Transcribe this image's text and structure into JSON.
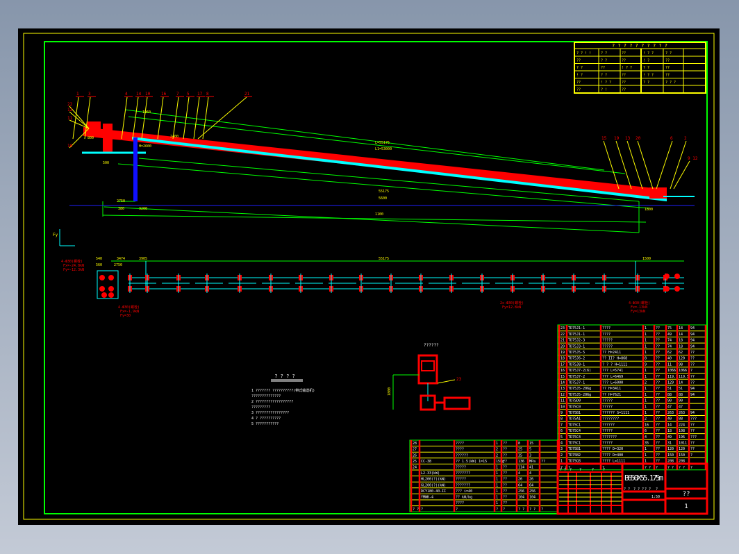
{
  "colors": {
    "frame": "#00ff00",
    "outer": "#ffff00",
    "structure": "#ff0000",
    "belt": "#00ffff",
    "dim": "#ffff00",
    "leader": "#ffff00",
    "pillar": "#1010ff"
  },
  "revision_table": {
    "title": "? ? ? ? ? ? ? ? ? ?",
    "cells": [
      "? ? ! !",
      "? ?",
      "??",
      "! ? ?",
      "? ?",
      "??",
      "? ?",
      "??",
      "! ?",
      "??",
      "? ?",
      "??",
      "! ? ?",
      "? ?",
      "??",
      "! ?",
      "? ?",
      "??",
      "! ? ?",
      "??",
      "??",
      "! ? ?",
      "??",
      "? ?",
      "? ? ?",
      "??",
      "? !",
      "??"
    ]
  },
  "side_view": {
    "top_callouts": [
      "1",
      "3",
      "4",
      "14",
      "10",
      "16",
      "7",
      "5",
      "17",
      "8",
      "21"
    ],
    "left_callouts": [
      "22",
      "12",
      "11",
      "10"
    ],
    "right_callouts": [
      "15",
      "19",
      "13",
      "20",
      "6",
      "2",
      "9  12"
    ],
    "dims": [
      "L=55175",
      "L1=53000",
      "55175",
      "5600",
      "2750",
      "380",
      "3200",
      "1960",
      "2400",
      "1100",
      "1800",
      "800",
      "500",
      "H=2600"
    ],
    "axis_label": "Fy"
  },
  "plan_view": {
    "dims": [
      "540",
      "3474",
      "3905",
      "55175",
      "1500",
      "560",
      "2750"
    ],
    "notes_left": [
      "4-Ф30(螺栓)",
      "Fx=-24.8kN",
      "Fy=-12.3kN"
    ],
    "notes_mid": [
      "2x-Ф30(螺栓)",
      "Fy=12.8kN"
    ],
    "notes_right": [
      "4-Ф30(螺栓)",
      "Fx=-13kN",
      "Fy=13kN"
    ],
    "notes_bottom": [
      "4-Ф30(螺栓)",
      "Fx=-1.9kN",
      "Fy=30"
    ]
  },
  "notes": {
    "title": "? ? ? ?",
    "lines": [
      "1 ??????? ??????????(带式输送机)",
      "  ??????????????",
      "2 ??????????????????",
      "  ?????????",
      "3 ????????????????",
      "4 ? ??????????",
      "5 ???????????"
    ]
  },
  "detail": {
    "title": "??????",
    "labels": [
      "23",
      "1800"
    ]
  },
  "parts": [
    [
      "23",
      "TD75J1-1",
      "????",
      "1",
      "??",
      "75",
      "18",
      "94"
    ],
    [
      "22",
      "TD75J1-1",
      "????",
      "1",
      "??",
      "49",
      "14",
      "94"
    ],
    [
      "21",
      "TD75J2-3",
      "?????",
      "1",
      "??",
      "74",
      "18",
      "94"
    ],
    [
      "20",
      "TD75J3-1",
      "?????",
      "1",
      "??",
      "74",
      "18",
      "94"
    ],
    [
      "19",
      "TD75J5-5",
      "?? H=2411",
      "1",
      "??",
      "62",
      "62",
      "??"
    ],
    [
      "18",
      "TD75J6-2",
      "?? II? H=868",
      "8",
      "??",
      "40",
      "120",
      "??"
    ],
    [
      "17",
      "TD75J8-1",
      "? ? ? H=1111",
      "9",
      "??",
      "11",
      "98",
      "??"
    ],
    [
      "16",
      "TD75J7-2(6)",
      "??? L=5741",
      "1",
      "??",
      "1066",
      "1066",
      "?"
    ],
    [
      "15",
      "TD75J7-2",
      "??? L=6469",
      "1",
      "??",
      "119.5",
      "119.5",
      "??"
    ],
    [
      "14",
      "TD75J7-1",
      "??? L=6000",
      "2",
      "??",
      "129",
      "14",
      "??"
    ],
    [
      "13",
      "TD75J5-206g",
      "?? H=3411",
      "1",
      "??",
      "51",
      "51",
      "94"
    ],
    [
      "12",
      "TD75J5-206g",
      "?? H=7621",
      "1",
      "??",
      "88",
      "88",
      "94"
    ],
    [
      "11",
      "TD75D0",
      "?????",
      "1",
      "??",
      "90",
      "90",
      ""
    ],
    [
      "10",
      "TD75C0",
      "?????",
      "1",
      "??",
      "47",
      "47",
      ""
    ],
    [
      "9",
      "TD75B1",
      "?????? S=1111",
      "1",
      "??",
      "263",
      "263",
      "94"
    ],
    [
      "8",
      "TD75A1",
      "????????",
      "2",
      "??",
      "40",
      "88",
      "???"
    ],
    [
      "7",
      "TD75C1",
      "??????",
      "16",
      "??",
      "14",
      "224",
      "??"
    ],
    [
      "6",
      "TD75C4",
      "?????",
      "6",
      "??",
      "18",
      "108",
      "??"
    ],
    [
      "5",
      "TD75C4",
      "???????",
      "4",
      "??",
      "49",
      "196",
      "???"
    ],
    [
      "4",
      "TD75C1",
      "?????",
      "35",
      "??",
      "31",
      "1011",
      "??"
    ],
    [
      "3",
      "TD75B1",
      "???? D=320",
      "1",
      "??",
      "120",
      "120",
      "??"
    ],
    [
      "2",
      "TD75B2",
      "???? D=400",
      "1",
      "??",
      "150",
      "150",
      "?"
    ],
    [
      "1",
      "TD75Q3",
      "???? L=1111",
      "1",
      "??",
      "208",
      "208",
      ""
    ]
  ],
  "parts_header": [
    "?  ?",
    "?",
    "?",
    "?  ?",
    "?",
    "? ? ?",
    "? ?",
    "?"
  ],
  "lower_parts": [
    [
      "28",
      "",
      "????",
      "1",
      "??",
      "8",
      "15",
      ""
    ],
    [
      "27",
      "",
      "????",
      "2",
      "??",
      "25",
      "5",
      ""
    ],
    [
      "26",
      "",
      "??????",
      "2",
      "??",
      "35",
      "3",
      ""
    ],
    [
      "25",
      "CC-38",
      "?? 1.5(kW) 1=15",
      "15kg",
      "??",
      "136",
      "MPa",
      "??"
    ],
    [
      "24",
      "",
      "?????",
      "1",
      "??",
      "114",
      "41",
      ""
    ],
    [
      "",
      "L2-33(kW)",
      "???????",
      "1",
      "??",
      "4",
      "4",
      ""
    ],
    [
      "",
      "HL200(?)(kW)",
      "?????",
      "1",
      "??",
      "26",
      "26",
      ""
    ],
    [
      "",
      "GL200(?)(kW)",
      "???????",
      "1",
      "??",
      "64",
      "64",
      ""
    ],
    [
      "",
      "DCY180-40-II",
      "??? i=40",
      "1",
      "??",
      "256",
      "256",
      ""
    ],
    [
      "",
      "YMWK-4",
      "?? kW/kg",
      "1",
      "??",
      "104",
      "104",
      ""
    ],
    [
      "",
      "",
      "????",
      "1",
      "??",
      "",
      "",
      ""
    ]
  ],
  "lower_header": [
    "? ?",
    "?",
    "?",
    "?",
    "?",
    "? ?",
    "? ?",
    "?"
  ],
  "title_block": {
    "drawing_name": "B650X55.175m",
    "code": "??",
    "sheet": "1",
    "scale": "1:50",
    "cells": [
      "? ?",
      "?",
      "?",
      "?",
      "?",
      "? ?",
      "? ? ?",
      "? ?",
      "?"
    ]
  }
}
